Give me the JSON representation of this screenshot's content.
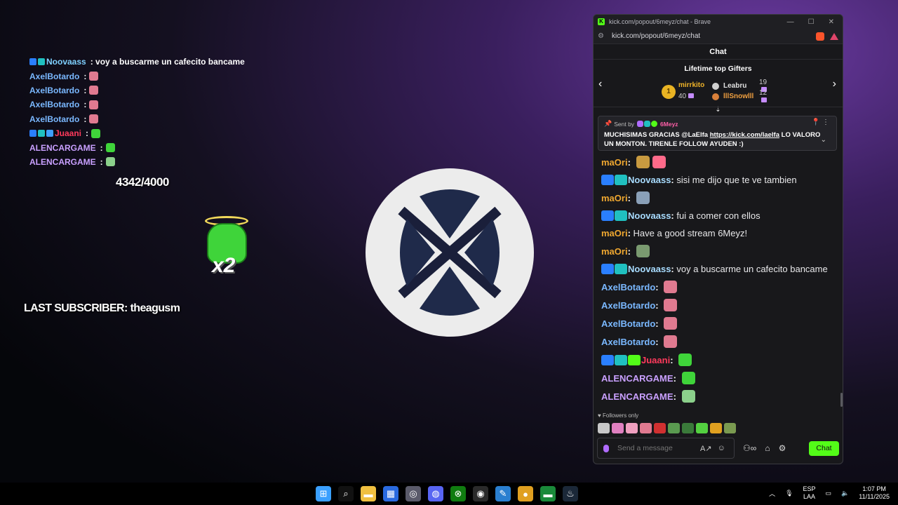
{
  "overlay": {
    "chat": [
      {
        "name": "Noovaass",
        "color": "#7fd0ff",
        "badges": [
          "#2a7fff",
          "#20c0c0"
        ],
        "msg": ": voy a buscarme un cafecito bancame",
        "emote": ""
      },
      {
        "name": "AxelBotardo",
        "color": "#7ab8ff",
        "badges": [],
        "msg": ":",
        "emote": "#e07a90"
      },
      {
        "name": "AxelBotardo",
        "color": "#7ab8ff",
        "badges": [],
        "msg": ":",
        "emote": "#e07a90"
      },
      {
        "name": "AxelBotardo",
        "color": "#7ab8ff",
        "badges": [],
        "msg": ":",
        "emote": "#e07a90"
      },
      {
        "name": "AxelBotardo",
        "color": "#7ab8ff",
        "badges": [],
        "msg": ":",
        "emote": "#e07a90"
      },
      {
        "name": "Juaani",
        "color": "#ff3a5c",
        "badges": [
          "#2a7fff",
          "#20c0c0",
          "#3fa0ff"
        ],
        "msg": ":",
        "emote": "#3fd43a"
      },
      {
        "name": "ALENCARGAME",
        "color": "#c9a0ff",
        "badges": [],
        "msg": ":",
        "emote": "#3fd43a"
      },
      {
        "name": "ALENCARGAME",
        "color": "#c9a0ff",
        "badges": [],
        "msg": ":",
        "emote": "#8bd08b"
      }
    ],
    "counter": "4342/4000",
    "multiplier": "x2",
    "last_subscriber": "LAST SUBSCRIBER: theagusm"
  },
  "browser": {
    "title": "kick.com/popout/6meyz/chat - Brave",
    "url": "kick.com/popout/6meyz/chat"
  },
  "chat": {
    "header": "Chat",
    "gifters_title": "Lifetime top Gifters",
    "top_gifter": {
      "rank": "1",
      "name": "mirrkito",
      "count": "40"
    },
    "other_gifters": [
      {
        "name": "Leabru",
        "count": "19",
        "color": "#d0d0d0",
        "name_color": "#e0e0e0"
      },
      {
        "name": "lllSnowlll",
        "count": "12",
        "color": "#d9803a",
        "name_color": "#f0a040"
      }
    ],
    "pinned": {
      "sent_by": "Sent by",
      "user": "6Meyz",
      "text_prefix": "MUCHISIMAS GRACIAS @LaElfa ",
      "link": "https://kick.com/laelfa",
      "text_suffix": " LO VALORO UN MONTON. TIRENLE FOLLOW AYUDEN :)"
    },
    "messages": [
      {
        "user": "maOri",
        "color": "#f0a830",
        "badges": [],
        "text": "",
        "emotes": [
          "#c89a40",
          "#ff6a8a"
        ]
      },
      {
        "user": "Noovaass",
        "color": "#a8dcff",
        "badges": [
          "#2a7fff",
          "#20c0c0"
        ],
        "text": "sisi me dijo que te ve tambien",
        "emotes": []
      },
      {
        "user": "maOri",
        "color": "#f0a830",
        "badges": [],
        "text": "",
        "emotes": [
          "#8aa0b8"
        ]
      },
      {
        "user": "Noovaass",
        "color": "#a8dcff",
        "badges": [
          "#2a7fff",
          "#20c0c0"
        ],
        "text": "fui a comer con ellos",
        "emotes": []
      },
      {
        "user": "maOri",
        "color": "#f0a830",
        "badges": [],
        "text": "Have a good stream 6Meyz!",
        "emotes": []
      },
      {
        "user": "maOri",
        "color": "#f0a830",
        "badges": [],
        "text": "",
        "emotes": [
          "#7a9a70"
        ]
      },
      {
        "user": "Noovaass",
        "color": "#a8dcff",
        "badges": [
          "#2a7fff",
          "#20c0c0"
        ],
        "text": "voy a buscarme un cafecito bancame",
        "emotes": []
      },
      {
        "user": "AxelBotardo",
        "color": "#7ab8ff",
        "badges": [],
        "text": "",
        "emotes": [
          "#e07a90"
        ]
      },
      {
        "user": "AxelBotardo",
        "color": "#7ab8ff",
        "badges": [],
        "text": "",
        "emotes": [
          "#e07a90"
        ]
      },
      {
        "user": "AxelBotardo",
        "color": "#7ab8ff",
        "badges": [],
        "text": "",
        "emotes": [
          "#e07a90"
        ]
      },
      {
        "user": "AxelBotardo",
        "color": "#7ab8ff",
        "badges": [],
        "text": "",
        "emotes": [
          "#e07a90"
        ]
      },
      {
        "user": "Juaani",
        "color": "#ff3a5c",
        "badges": [
          "#2a7fff",
          "#20c0c0",
          "#53fc18"
        ],
        "text": "",
        "emotes": [
          "#3fd43a"
        ]
      },
      {
        "user": "ALENCARGAME",
        "color": "#c9a0ff",
        "badges": [],
        "text": "",
        "emotes": [
          "#3fd43a"
        ]
      },
      {
        "user": "ALENCARGAME",
        "color": "#c9a0ff",
        "badges": [],
        "text": "",
        "emotes": [
          "#8bd08b"
        ]
      }
    ],
    "followers_only": "Followers only",
    "emote_bar": [
      "#c8c8c8",
      "#e080c0",
      "#f0a0c0",
      "#e07a90",
      "#d03030",
      "#5a9a50",
      "#3a7a3a",
      "#53d040",
      "#e0a020",
      "#7a9a50"
    ],
    "input_placeholder": "Send a message",
    "chat_button": "Chat"
  },
  "taskbar": {
    "icons": [
      "windows-start-icon",
      "search-icon",
      "file-explorer-icon",
      "store-icon",
      "browser-icon",
      "discord-icon",
      "xbox-icon",
      "obs-icon",
      "notepad-icon",
      "chrome-icon",
      "terminal-icon",
      "steam-icon"
    ],
    "lang_top": "ESP",
    "lang_bottom": "LAA",
    "time": "1:07 PM",
    "date": "11/11/2025"
  },
  "colors": {
    "kick_green": "#53fc18",
    "accent_purple": "#b06cff"
  }
}
